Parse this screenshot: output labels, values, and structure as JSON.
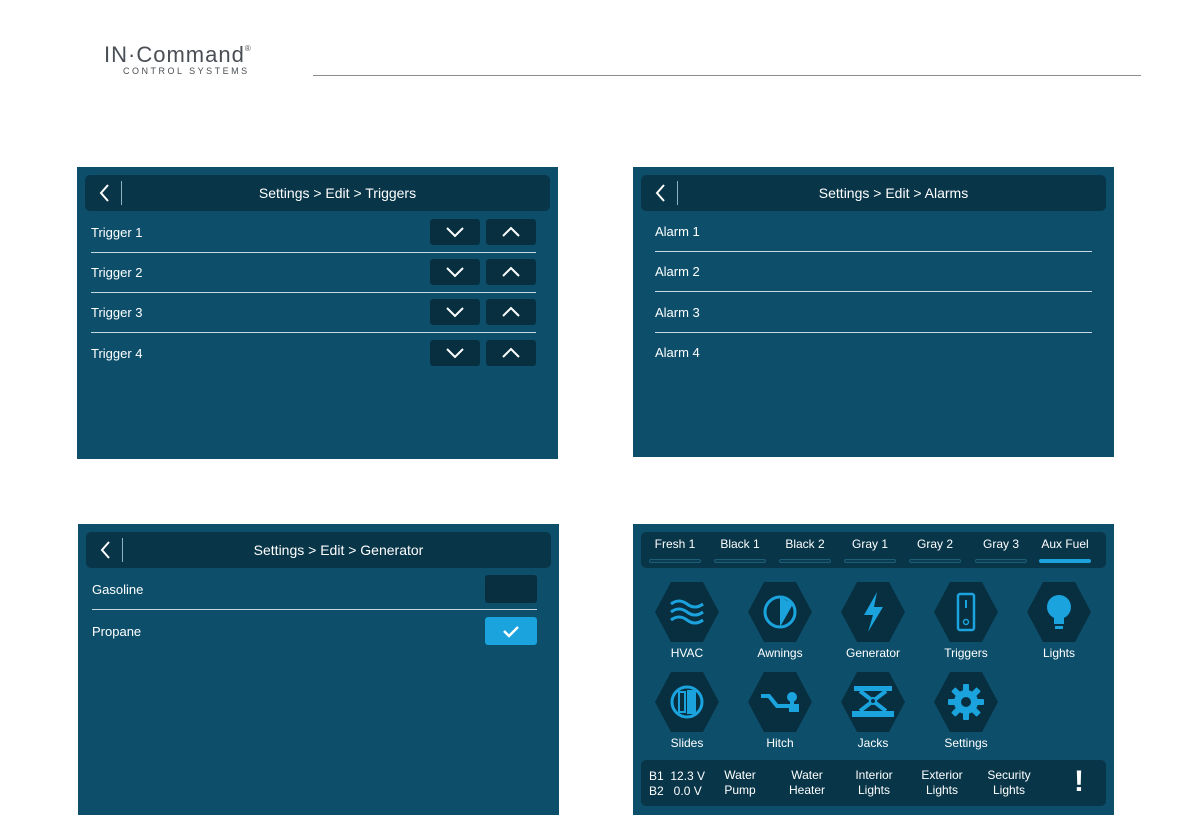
{
  "brand": {
    "name": "IN·Command",
    "mark": "®",
    "tagline": "CONTROL SYSTEMS"
  },
  "triggers_panel": {
    "title": "Settings > Edit > Triggers",
    "rows": [
      {
        "label": "Trigger 1"
      },
      {
        "label": "Trigger 2"
      },
      {
        "label": "Trigger 3"
      },
      {
        "label": "Trigger 4"
      }
    ]
  },
  "alarms_panel": {
    "title": "Settings > Edit > Alarms",
    "rows": [
      {
        "label": "Alarm 1"
      },
      {
        "label": "Alarm 2"
      },
      {
        "label": "Alarm 3"
      },
      {
        "label": "Alarm 4"
      }
    ]
  },
  "generator_panel": {
    "title": "Settings > Edit > Generator",
    "options": [
      {
        "label": "Gasoline",
        "checked": false
      },
      {
        "label": "Propane",
        "checked": true
      }
    ]
  },
  "dashboard": {
    "tanks": [
      {
        "label": "Fresh 1",
        "active": false
      },
      {
        "label": "Black 1",
        "active": false
      },
      {
        "label": "Black 2",
        "active": false
      },
      {
        "label": "Gray 1",
        "active": false
      },
      {
        "label": "Gray 2",
        "active": false
      },
      {
        "label": "Gray 3",
        "active": false
      },
      {
        "label": "Aux Fuel",
        "active": true
      }
    ],
    "tiles": [
      {
        "label": "HVAC",
        "icon": "hvac-icon"
      },
      {
        "label": "Awnings",
        "icon": "awnings-icon"
      },
      {
        "label": "Generator",
        "icon": "generator-icon"
      },
      {
        "label": "Triggers",
        "icon": "triggers-icon"
      },
      {
        "label": "Lights",
        "icon": "lights-icon"
      },
      {
        "label": "Slides",
        "icon": "slides-icon"
      },
      {
        "label": "Hitch",
        "icon": "hitch-icon"
      },
      {
        "label": "Jacks",
        "icon": "jacks-icon"
      },
      {
        "label": "Settings",
        "icon": "settings-icon"
      }
    ],
    "battery": {
      "b1": "B1  12.3 V",
      "b2": "B2   0.0 V"
    },
    "status": [
      {
        "line1": "Water",
        "line2": "Pump"
      },
      {
        "line1": "Water",
        "line2": "Heater"
      },
      {
        "line1": "Interior",
        "line2": "Lights"
      },
      {
        "line1": "Exterior",
        "line2": "Lights"
      },
      {
        "line1": "Security",
        "line2": "Lights"
      }
    ],
    "alert": "!"
  },
  "colors": {
    "panel": "#0d4f6b",
    "bar": "#083548",
    "button": "#072f40",
    "accent": "#1aa3dd"
  }
}
